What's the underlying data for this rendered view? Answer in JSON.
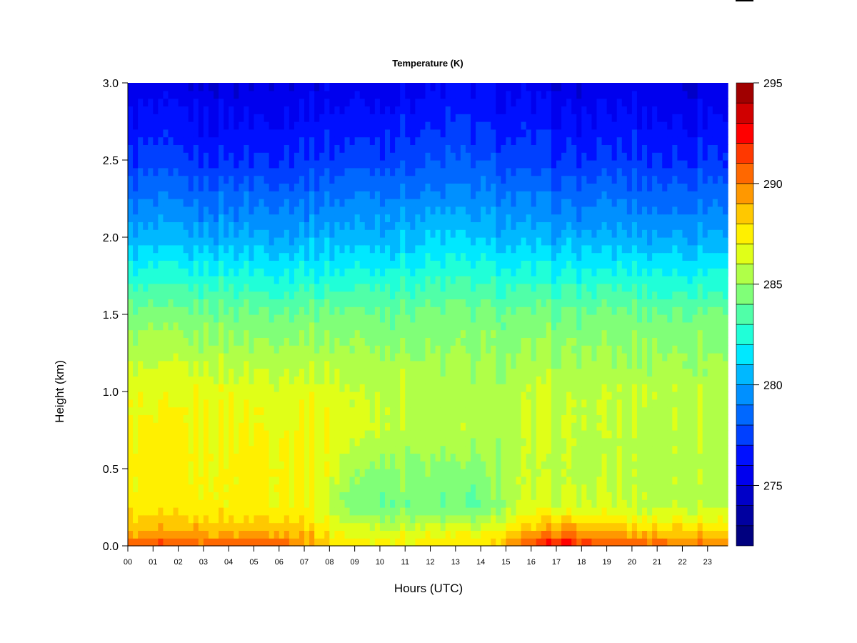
{
  "chart_data": {
    "type": "heatmap",
    "title": "Temperature (K)",
    "xlabel": "Hours (UTC)",
    "ylabel": "Height (km)",
    "xlim": [
      0,
      23.8
    ],
    "ylim": [
      0,
      3.0
    ],
    "x_ticks": [
      "00",
      "01",
      "02",
      "03",
      "04",
      "05",
      "06",
      "07",
      "08",
      "09",
      "10",
      "11",
      "12",
      "13",
      "14",
      "15",
      "16",
      "17",
      "18",
      "19",
      "20",
      "21",
      "22",
      "23"
    ],
    "y_ticks": [
      "0.0",
      "0.5",
      "1.0",
      "1.5",
      "2.0",
      "2.5",
      "3.0"
    ],
    "colorbar": {
      "range": [
        272,
        295
      ],
      "ticks": [
        "275",
        "280",
        "285",
        "290",
        "295"
      ],
      "colors": [
        "#00007F",
        "#0000A0",
        "#0000C8",
        "#0000EE",
        "#0010FF",
        "#0040FF",
        "#0068FF",
        "#0090FF",
        "#00B8FF",
        "#00E8FF",
        "#20FFD8",
        "#50FFA8",
        "#80FF78",
        "#B0FF48",
        "#E0FF18",
        "#FFF000",
        "#FFC800",
        "#FF9800",
        "#FF6800",
        "#FF3800",
        "#FF0000",
        "#D00000",
        "#A00000",
        "#800000"
      ]
    },
    "hours": [
      0,
      1,
      2,
      3,
      4,
      5,
      6,
      7,
      8,
      9,
      10,
      11,
      12,
      13,
      14,
      15,
      16,
      17,
      18,
      19,
      20,
      21,
      22,
      23
    ],
    "heights_km": [
      0,
      0.1,
      0.25,
      0.5,
      0.75,
      1.0,
      1.5,
      2.0,
      2.5,
      3.0
    ],
    "values_K": [
      [
        291,
        291,
        291,
        291,
        291,
        291,
        291,
        290,
        288.5,
        287.5,
        287.5,
        287.5,
        287.5,
        287.5,
        287.5,
        289,
        291,
        293,
        292,
        291,
        291,
        291,
        290,
        290
      ],
      [
        288.8,
        288.8,
        288.8,
        288.8,
        288.8,
        288.8,
        288.8,
        288.6,
        287.2,
        286.5,
        286.5,
        286.5,
        286.5,
        286.5,
        286.5,
        287.5,
        288.5,
        289.5,
        289,
        289,
        288.3,
        288.3,
        288.3,
        288.3
      ],
      [
        287.4,
        287.4,
        287.4,
        287.4,
        287.4,
        287.4,
        287.4,
        287.3,
        286,
        284.3,
        284.3,
        284.3,
        284.3,
        283.8,
        283.8,
        285.5,
        286.2,
        286.3,
        286.2,
        286.2,
        285.8,
        285.8,
        285.8,
        285.8
      ],
      [
        287.3,
        287.3,
        287.3,
        287.3,
        287.3,
        287.3,
        287.3,
        287.2,
        286.5,
        285,
        285,
        285,
        284.8,
        284.5,
        284.5,
        285.6,
        285.6,
        285.6,
        285.6,
        285.6,
        285.6,
        285.6,
        285.6,
        285.6
      ],
      [
        287.1,
        287.1,
        287.1,
        287.1,
        287.1,
        287.1,
        287.1,
        287.1,
        287,
        286.2,
        286.2,
        285.6,
        285.6,
        285.6,
        285.6,
        285.6,
        285.8,
        285.8,
        285.8,
        285.8,
        285.8,
        285.8,
        285.8,
        285.8
      ],
      [
        286.6,
        286.6,
        286.6,
        286.6,
        286.6,
        286.6,
        286.6,
        286.6,
        286.6,
        286,
        286,
        286,
        285.5,
        285.5,
        285.5,
        285.5,
        285.8,
        285.8,
        285.8,
        285.8,
        285.8,
        285.8,
        285.8,
        285.8
      ],
      [
        284.3,
        284.3,
        284.3,
        284.3,
        284.3,
        284.3,
        284.3,
        284.3,
        284.3,
        284.3,
        284.3,
        284.2,
        284.3,
        284.4,
        284.3,
        284.2,
        284.2,
        284.2,
        284.2,
        284.2,
        284.2,
        284.2,
        284.2,
        284.2
      ],
      [
        280.3,
        280.3,
        280.3,
        280.2,
        280.3,
        280.3,
        280.3,
        280.3,
        280.4,
        280.5,
        280.6,
        280.7,
        280.9,
        281,
        280.8,
        280.5,
        280.4,
        280.3,
        280.3,
        280.3,
        280.3,
        280.2,
        280.2,
        280.3
      ],
      [
        277.2,
        277.3,
        277.2,
        277,
        277.1,
        277.2,
        277.2,
        277.3,
        277.4,
        277.5,
        277.6,
        277.7,
        277.8,
        278,
        277.8,
        277.6,
        277.4,
        277.2,
        277.1,
        277.2,
        277.3,
        277.2,
        277,
        277.2
      ],
      [
        275.2,
        275.3,
        275.2,
        275,
        275.1,
        275.2,
        275.2,
        275.3,
        275.4,
        275.5,
        275.6,
        275.7,
        275.8,
        276,
        275.8,
        275.6,
        275.4,
        275.2,
        275.1,
        275.2,
        275.3,
        275.2,
        275,
        275.2
      ]
    ]
  }
}
